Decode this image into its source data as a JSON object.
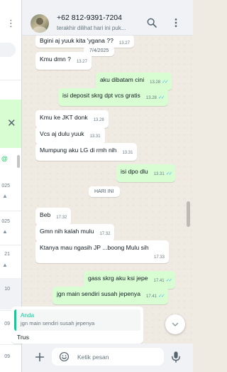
{
  "header": {
    "contact_name": "+62 812-9391-7204",
    "status": "terakhir dilihat hari ini puk..."
  },
  "left_list": {
    "times": [
      "025",
      "025",
      "21",
      "10",
      "09",
      "09"
    ]
  },
  "chat": {
    "date_1": "7/4/2025",
    "date_today": "HARI INI",
    "messages": [
      {
        "text": "Bgini aj yuuk kita 'ygana ??",
        "time": "13.27"
      },
      {
        "text": "Kmu dmn ?",
        "time": "13.27"
      },
      {
        "text": "aku dibatam cini",
        "time": "13.28"
      },
      {
        "text": "isi deposit skrg dpt vcs gratis",
        "time": "13.28"
      },
      {
        "text": "Kmu ke JKT donk",
        "time": "13.28"
      },
      {
        "text": "Vcs aj dulu yuuk",
        "time": "13.31"
      },
      {
        "text": "Mumpung aku LG di rmh nih",
        "time": "13.31"
      },
      {
        "text": "isi dpo dlu",
        "time": "13.31"
      },
      {
        "text": "Beb",
        "time": "17.32"
      },
      {
        "text": "Gmn nih kalah mulu",
        "time": "17.32"
      },
      {
        "text": "Ktanya mau ngasih JP ...boong Mulu sih",
        "time": "17.33"
      },
      {
        "text": "gass skrg aku ksi jepe",
        "time": "17.41"
      },
      {
        "text": "jgn main sendiri susah jepenya",
        "time": "17.41"
      }
    ],
    "quote": {
      "author": "Anda",
      "text": "jgn main sendiri susah jepenya",
      "reply": "Trus"
    }
  },
  "footer": {
    "placeholder": "Ketik pesan"
  },
  "colors": {
    "outgoing": "#d9fdd3",
    "incoming": "#ffffff",
    "chat_bg": "#efeae2",
    "tick_read": "#53bdeb",
    "accent": "#06cf9c"
  }
}
